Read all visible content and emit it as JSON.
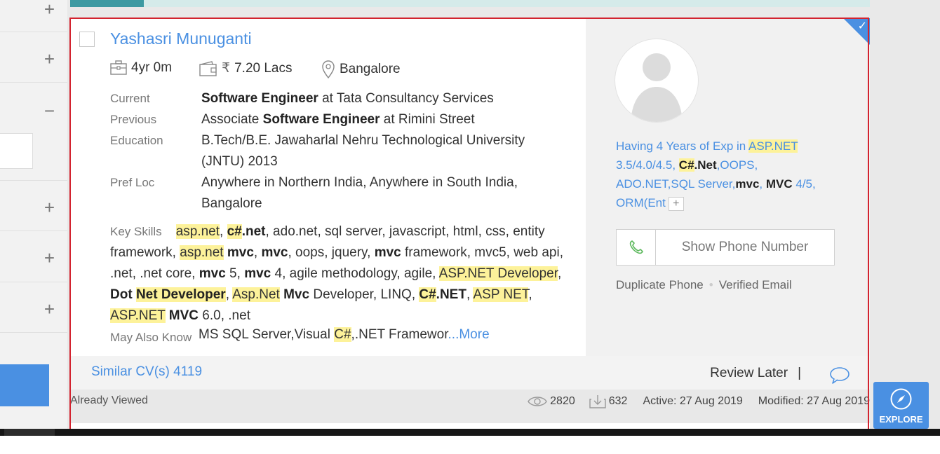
{
  "sidebar": {
    "toggles": [
      "+",
      "+",
      "−",
      "+",
      "+",
      "+"
    ]
  },
  "candidate": {
    "name": "Yashasri Munuganti",
    "experience": "4yr 0m",
    "salary": "7.20 Lacs",
    "currency": "₹",
    "location": "Bangalore",
    "labels": {
      "current": "Current",
      "previous": "Previous",
      "education": "Education",
      "pref_loc": "Pref Loc",
      "key_skills": "Key Skills",
      "may_also_know": "May Also Know"
    },
    "current": {
      "role": "Software Engineer",
      "at": " at Tata Consultancy Services"
    },
    "previous": {
      "pre": "Associate ",
      "role": "Software Engineer",
      "at": " at Rimini Street"
    },
    "education": "B.Tech/B.E. Jawaharlal Nehru Technological University (JNTU) 2013",
    "pref_loc": "Anywhere in Northern India, Anywhere in South India, Bangalore",
    "may_also_know": {
      "text": "MS SQL Server,Visual ",
      "hl": "C#",
      "rest": ",.NET Framewor",
      "more": "...More"
    }
  },
  "summary": {
    "p1": "Having 4 Years of Exp in ",
    "h1": "ASP.NET",
    "p2": " 3.5/4.0/4.5, ",
    "h2": "C#",
    "b2": ".Net",
    "p3": ",OOPS, ADO.NET,SQL Server,",
    "b3": "mvc",
    "p4": ", ",
    "b4": "MVC",
    "p5": " 4/5, ORM(Ent",
    "plus": "+"
  },
  "contact": {
    "phone_btn": "Show Phone Number",
    "dup": "Duplicate Phone",
    "verified": "Verified Email"
  },
  "footer": {
    "similar": "Similar CV(s) 4119",
    "review": "Review Later",
    "sep": "|",
    "viewed": "Already Viewed",
    "views": "2820",
    "downloads": "632",
    "active": "Active: 27 Aug 2019",
    "modified": "Modified: 27 Aug 2019"
  },
  "explore": {
    "label": "EXPLORE"
  },
  "colors": {
    "accent": "#4a90e2",
    "highlight": "#fdf29a",
    "outline": "#d3232f"
  }
}
